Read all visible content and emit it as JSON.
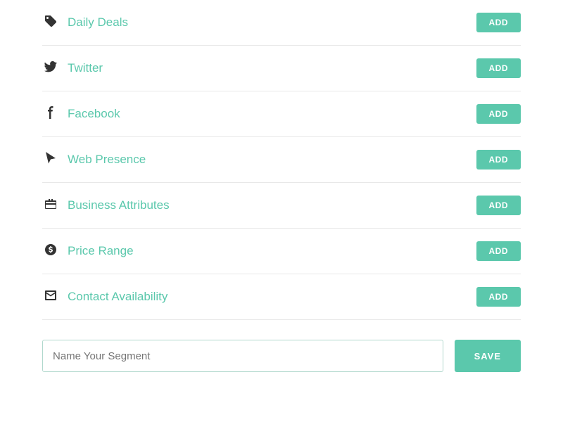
{
  "rows": [
    {
      "id": "daily-deals",
      "label": "Daily Deals",
      "icon": "tag",
      "add_label": "ADD"
    },
    {
      "id": "twitter",
      "label": "Twitter",
      "icon": "twitter",
      "add_label": "ADD"
    },
    {
      "id": "facebook",
      "label": "Facebook",
      "icon": "facebook",
      "add_label": "ADD"
    },
    {
      "id": "web-presence",
      "label": "Web Presence",
      "icon": "cursor",
      "add_label": "ADD"
    },
    {
      "id": "business-attributes",
      "label": "Business Attributes",
      "icon": "briefcase",
      "add_label": "ADD"
    },
    {
      "id": "price-range",
      "label": "Price Range",
      "icon": "money",
      "add_label": "ADD"
    },
    {
      "id": "contact-availability",
      "label": "Contact Availability",
      "icon": "envelope",
      "add_label": "ADD"
    }
  ],
  "input": {
    "placeholder": "Name Your Segment"
  },
  "save_label": "SAVE"
}
